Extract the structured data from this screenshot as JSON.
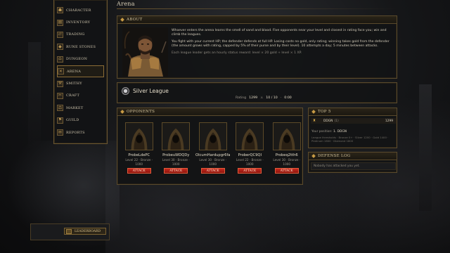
{
  "page": {
    "title": "Arena"
  },
  "sidebar": {
    "items": [
      {
        "label": "Character",
        "icon": "character-icon",
        "glyph": "☗",
        "active": false
      },
      {
        "label": "Inventory",
        "icon": "inventory-icon",
        "glyph": "▤",
        "active": false
      },
      {
        "label": "Trading",
        "icon": "trading-icon",
        "glyph": "⇄",
        "active": false
      },
      {
        "label": "Rune Stones",
        "icon": "rune-stone-icon",
        "glyph": "◆",
        "active": false
      },
      {
        "label": "Dungeon",
        "icon": "dungeon-icon",
        "glyph": "⌂",
        "active": false
      },
      {
        "label": "Arena",
        "icon": "crossed-swords-icon",
        "glyph": "✕",
        "active": true
      },
      {
        "label": "Smithy",
        "icon": "anvil-icon",
        "glyph": "⚒",
        "active": false
      },
      {
        "label": "Craft",
        "icon": "craft-icon",
        "glyph": "✂",
        "active": false
      },
      {
        "label": "Market",
        "icon": "market-icon",
        "glyph": "⚖",
        "active": false
      },
      {
        "label": "Guild",
        "icon": "guild-icon",
        "glyph": "⚑",
        "active": false
      },
      {
        "label": "Reports",
        "icon": "reports-icon",
        "glyph": "✉",
        "active": false
      }
    ]
  },
  "bottom_panel": {
    "button_label": "Leaderboard"
  },
  "about": {
    "title": "About",
    "paragraphs": [
      "Whoever enters the arena learns the smell of sand and blood. Five opponents near your level and closest in rating face you; win and climb the leagues.",
      "You fight with your current HP; the defender defends at full HP. Losing costs no gold, only rating; winning takes gold from the defender (the amount grows with rating, capped by 5% of their purse and by their level). 10 attempts a day; 5 minutes between attacks."
    ],
    "note": "Each league leader gets an hourly status reward: level × 20 gold + level × 1 XP."
  },
  "league": {
    "name": "Silver League",
    "rating_label": "Rating",
    "rating": "1299",
    "attempts": "10 / 10",
    "timer": "0:00",
    "attempts_icon": "crossed-swords-icon",
    "timer_icon": "clock-icon"
  },
  "opponents": {
    "title": "Opponents",
    "attack_label": "Attack",
    "list": [
      {
        "name": "ProbeLdePC",
        "level": "Level 22 · Bronze ·",
        "rating": "1000"
      },
      {
        "name": "ProbeuWDQDy",
        "level": "Level 30 · Bronze ·",
        "rating": "1000"
      },
      {
        "name": "OlcumHardupgr6fa",
        "level": "Level 30 · Bronze ·",
        "rating": "1000"
      },
      {
        "name": "ProberQC9QI",
        "level": "Level 22 · Bronze ·",
        "rating": "1000"
      },
      {
        "name": "Probeq2tth6",
        "level": "Level 30 · Bronze ·",
        "rating": "1000"
      }
    ]
  },
  "top5": {
    "title": "Top 5",
    "rows": [
      {
        "name": "DDGN",
        "rank": "(1)",
        "rating": "1299"
      }
    ],
    "your_position_label": "Your position:",
    "your_position": "1. DDGN",
    "note": "League thresholds · Bronze 0+ · Silver 1200 · Gold 1400 · Platinum 1600 · Diamond 1800"
  },
  "defense_log": {
    "title": "Defense Log",
    "empty_text": "Nobody has attacked you yet."
  },
  "colors": {
    "gold_accent": "#c89b45",
    "attack_red": "#c92a1e",
    "panel_border": "#5a4a2c"
  }
}
